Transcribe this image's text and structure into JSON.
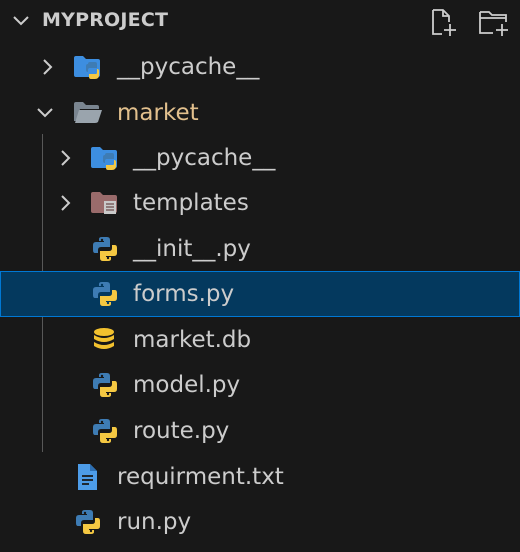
{
  "explorer": {
    "title": "MYPROJECT",
    "actions": [
      {
        "name": "new-file-button",
        "icon": "new-file-icon"
      },
      {
        "name": "new-folder-button",
        "icon": "new-folder-icon"
      }
    ]
  },
  "tree": [
    {
      "label": "__pycache__",
      "type": "folder",
      "icon": "python-folder-icon",
      "state": "collapsed",
      "depth": 0
    },
    {
      "label": "market",
      "type": "folder",
      "icon": "folder-open-icon",
      "state": "expanded",
      "depth": 0
    },
    {
      "label": "__pycache__",
      "type": "folder",
      "icon": "python-folder-icon",
      "state": "collapsed",
      "depth": 1
    },
    {
      "label": "templates",
      "type": "folder",
      "icon": "templates-folder-icon",
      "state": "collapsed",
      "depth": 1
    },
    {
      "label": "__init__.py",
      "type": "file",
      "icon": "python-icon",
      "depth": 1
    },
    {
      "label": "forms.py",
      "type": "file",
      "icon": "python-icon",
      "depth": 1,
      "selected": true
    },
    {
      "label": "market.db",
      "type": "file",
      "icon": "database-icon",
      "depth": 1
    },
    {
      "label": "model.py",
      "type": "file",
      "icon": "python-icon",
      "depth": 1
    },
    {
      "label": "route.py",
      "type": "file",
      "icon": "python-icon",
      "depth": 1
    },
    {
      "label": "requirment.txt",
      "type": "file",
      "icon": "text-file-icon",
      "depth": 0
    },
    {
      "label": "run.py",
      "type": "file",
      "icon": "python-icon",
      "depth": 0
    }
  ],
  "colors": {
    "background": "#181818",
    "text": "#cccccc",
    "open_folder_text": "#e2c08d",
    "selection_bg": "#04395e",
    "selection_border": "#0078d4",
    "python_blue": "#3e7cb4",
    "python_yellow": "#f5c842",
    "folder_blue": "#3d8ee0",
    "folder_grey": "#7a8590",
    "templates_folder": "#9a6b6b",
    "database_yellow": "#f2c12e",
    "text_file_blue": "#4d9ce8"
  }
}
